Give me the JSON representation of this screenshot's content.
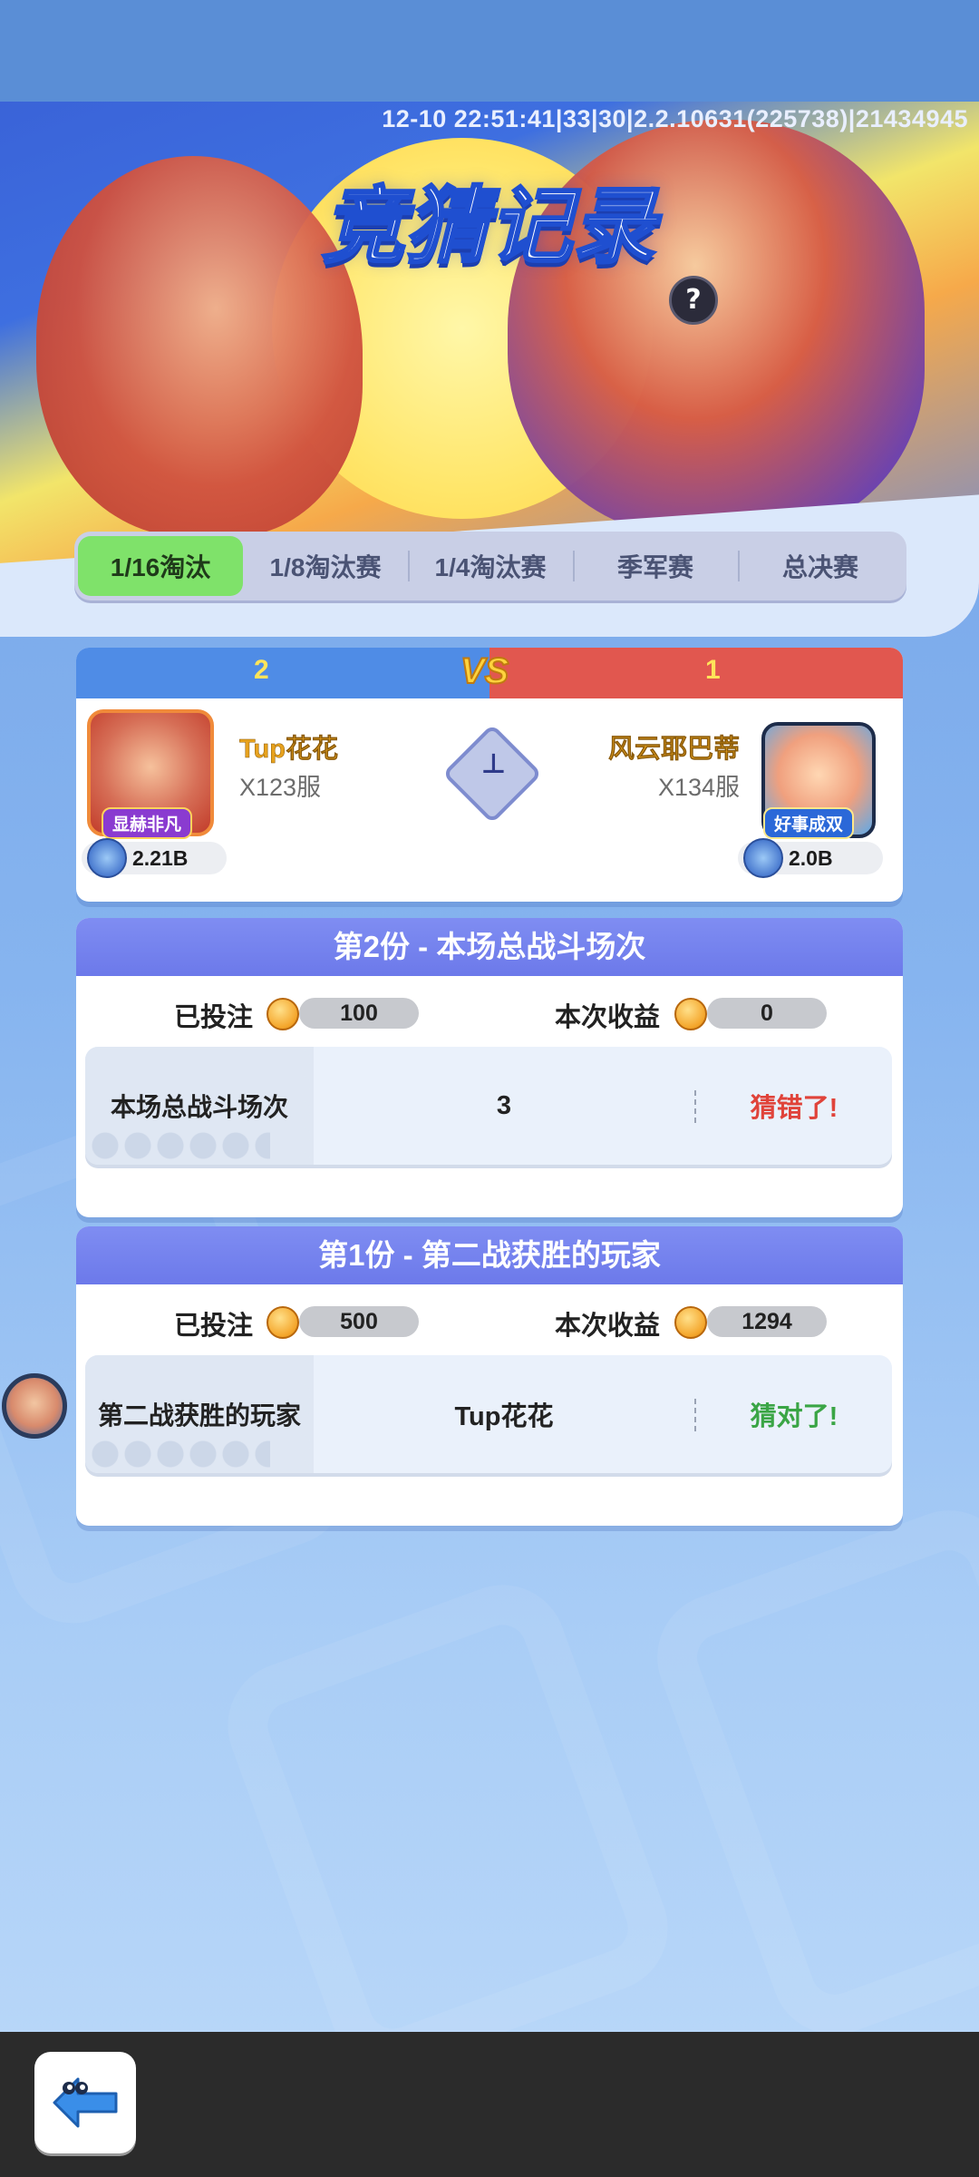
{
  "debug_info": "12-10 22:51:41|33|30|2.2.10631(225738)|21434945",
  "page_title": "竞猜记录",
  "help_icon": "?",
  "tabs": [
    {
      "label": "1/16淘汰",
      "active": true
    },
    {
      "label": "1/8淘汰赛",
      "active": false
    },
    {
      "label": "1/4淘汰赛",
      "active": false
    },
    {
      "label": "季军赛",
      "active": false
    },
    {
      "label": "总决赛",
      "active": false
    }
  ],
  "match": {
    "vs_label": "VS",
    "left": {
      "score": "2",
      "name": "Tup花花",
      "server": "X123服",
      "tag": "显赫非凡",
      "power": "2.21B"
    },
    "right": {
      "score": "1",
      "name": "风云耶巴蒂",
      "server": "X134服",
      "tag": "好事成双",
      "power": "2.0B"
    }
  },
  "bets": [
    {
      "title": "第2份 - 本场总战斗场次",
      "staked_label": "已投注",
      "staked_value": "100",
      "earnings_label": "本次收益",
      "earnings_value": "0",
      "question": "本场总战斗场次",
      "answer": "3",
      "result": "猜错了!",
      "result_color": "#e0433a"
    },
    {
      "title": "第1份 - 第二战获胜的玩家",
      "staked_label": "已投注",
      "staked_value": "500",
      "earnings_label": "本次收益",
      "earnings_value": "1294",
      "question": "第二战获胜的玩家",
      "answer": "Tup花花",
      "result": "猜对了!",
      "result_color": "#3aa545"
    }
  ],
  "icons": {
    "help": "question-mark-icon",
    "coin": "coin-icon",
    "power": "sword-icon",
    "back": "back-arrow-icon"
  },
  "colors": {
    "active_tab": "#7fe26a",
    "team_blue": "#4f8ce6",
    "team_red": "#e1574f",
    "bet_header": "#7f8df2"
  }
}
